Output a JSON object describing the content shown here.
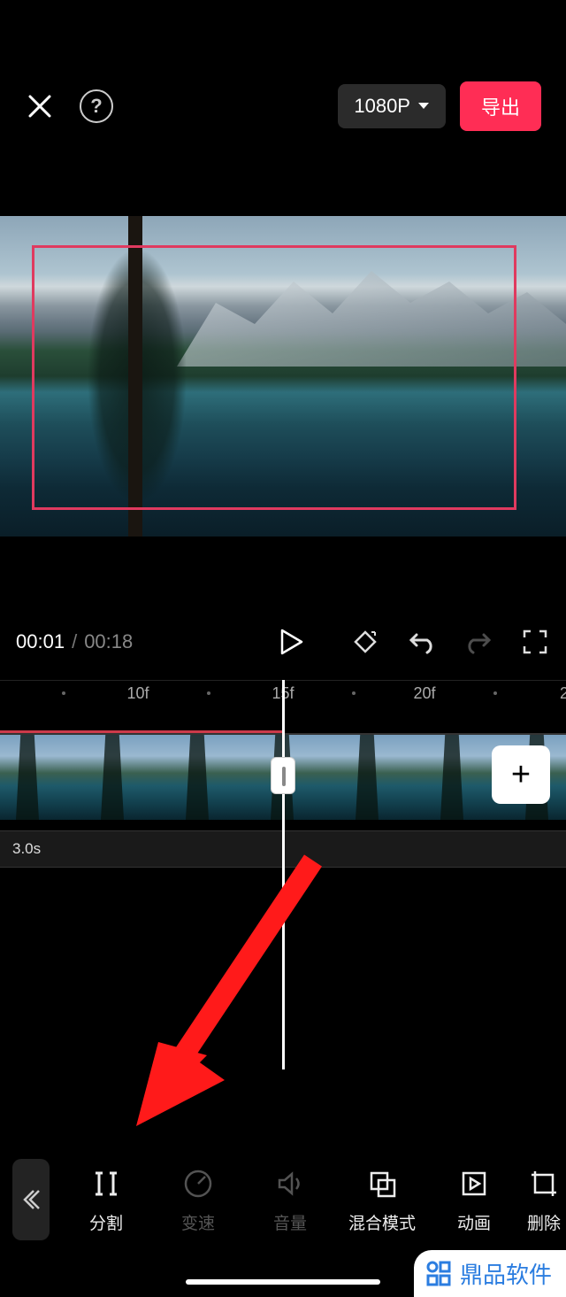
{
  "header": {
    "resolution": "1080P",
    "export_label": "导出"
  },
  "playback": {
    "current_time": "00:01",
    "separator": "/",
    "total_time": "00:18"
  },
  "ruler": {
    "labels": [
      "10f",
      "15f",
      "20f"
    ],
    "trailing": "2"
  },
  "timeline": {
    "sub_duration": "3.0s",
    "add_label": "+"
  },
  "toolbar": {
    "items": [
      {
        "label": "分割",
        "icon": "split-icon",
        "disabled": false
      },
      {
        "label": "变速",
        "icon": "speed-icon",
        "disabled": true
      },
      {
        "label": "音量",
        "icon": "volume-icon",
        "disabled": true
      },
      {
        "label": "混合模式",
        "icon": "blend-icon",
        "disabled": false
      },
      {
        "label": "动画",
        "icon": "animation-icon",
        "disabled": false
      },
      {
        "label": "删除",
        "icon": "crop-tool-icon",
        "disabled": false
      }
    ]
  },
  "watermark": {
    "text": "鼎品软件"
  }
}
